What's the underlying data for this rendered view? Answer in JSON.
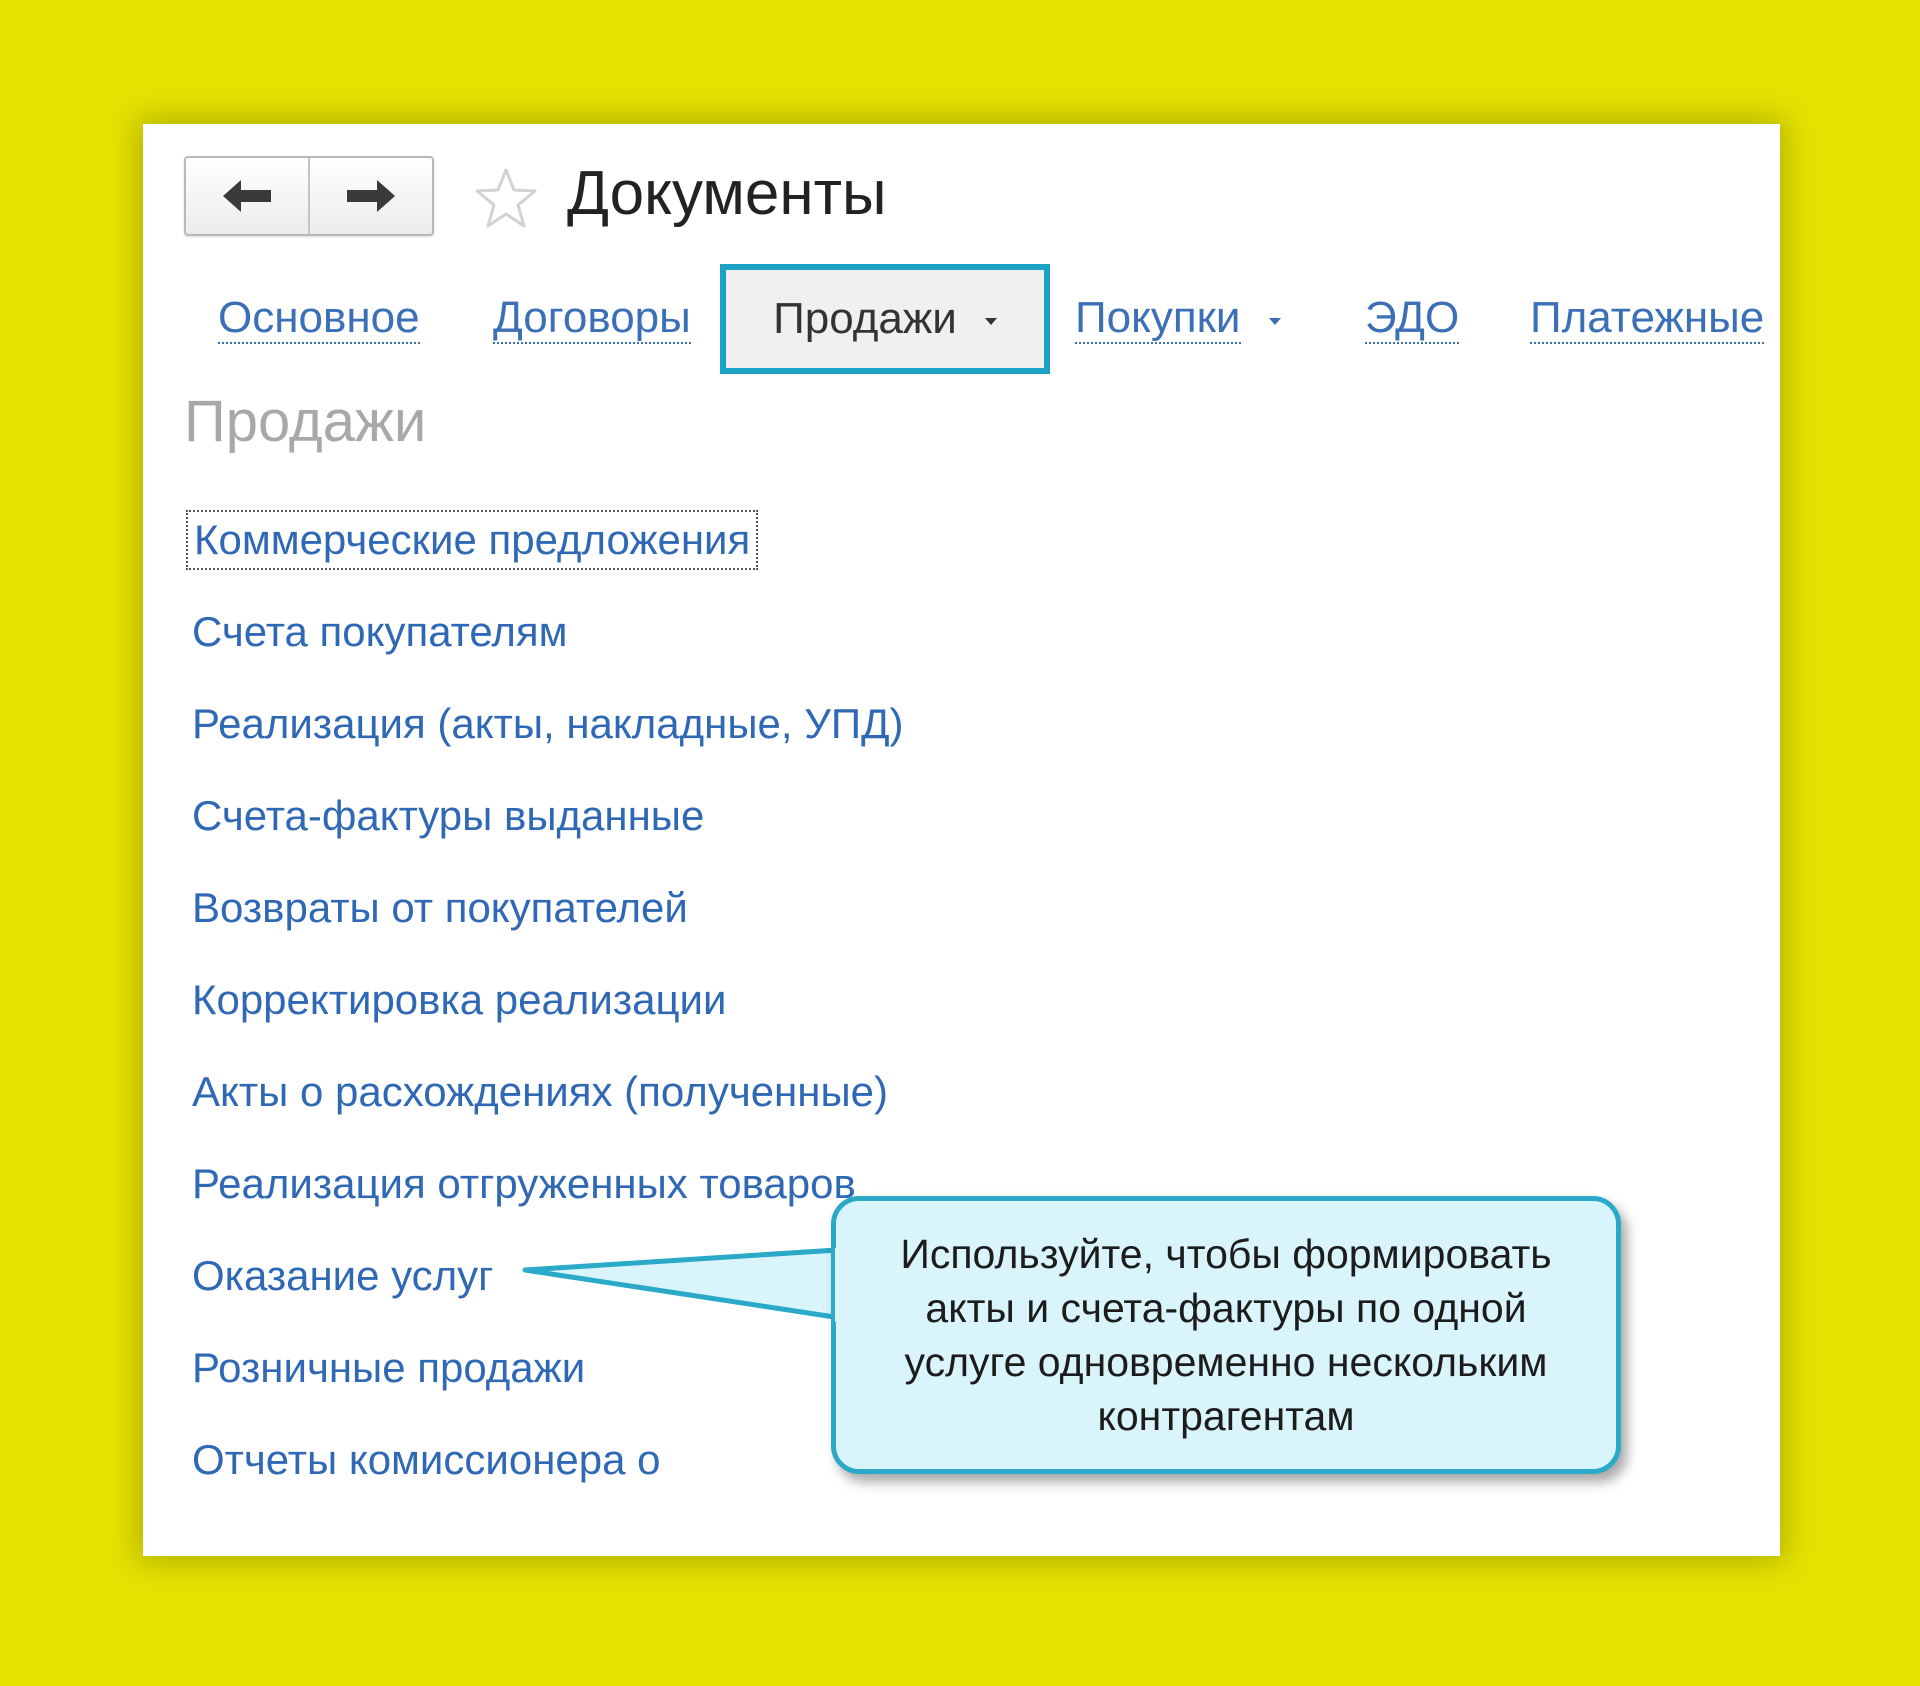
{
  "window": {
    "title": "Документы"
  },
  "nav": {
    "back_icon": "arrow-left-icon",
    "forward_icon": "arrow-right-icon",
    "favorite_icon": "star-icon"
  },
  "tabs": [
    {
      "label": "Основное",
      "active": false,
      "has_dropdown": false
    },
    {
      "label": "Договоры",
      "active": false,
      "has_dropdown": false
    },
    {
      "label": "Продажи",
      "active": true,
      "has_dropdown": true
    },
    {
      "label": "Покупки",
      "active": false,
      "has_dropdown": true
    },
    {
      "label": "ЭДО",
      "active": false,
      "has_dropdown": false
    },
    {
      "label": "Платежные",
      "active": false,
      "has_dropdown": false
    }
  ],
  "section": {
    "title": "Продажи",
    "links": [
      "Коммерческие предложения",
      "Счета покупателям",
      "Реализация (акты, накладные, УПД)",
      "Счета-фактуры выданные",
      "Возвраты от покупателей",
      "Корректировка реализации",
      "Акты о расхождениях (полученные)",
      "Реализация отгруженных товаров",
      "Оказание услуг",
      "Розничные продажи",
      "Отчеты комиссионера о"
    ]
  },
  "callout": {
    "text": "Используйте, чтобы формировать акты и счета-фактуры по одной услуге одновременно нескольким контрагентам"
  },
  "colors": {
    "background": "#e6e200",
    "link": "#2f68b4",
    "active_tab_border": "#1aa3c4",
    "callout_fill": "#d9f5fb",
    "callout_border": "#2aa9c8"
  }
}
